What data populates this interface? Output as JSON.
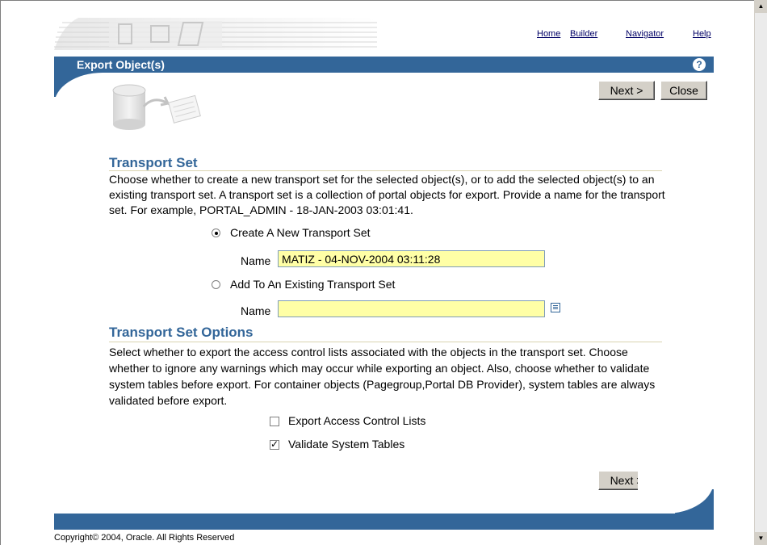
{
  "nav": {
    "home": "Home",
    "builder": "Builder",
    "navigator": "Navigator",
    "help": "Help"
  },
  "header": {
    "title": "Export Object(s)",
    "help_icon": "?"
  },
  "buttons": {
    "next": "Next >",
    "close": "Close"
  },
  "transport_set": {
    "title": "Transport Set",
    "description": "Choose whether to create a new transport set for the selected object(s), or to add the selected object(s) to an existing transport set. A transport set is a collection of portal objects for export. Provide a name for the transport set. For example, PORTAL_ADMIN - 18-JAN-2003 03:01:41.",
    "create_new_label": "Create A New Transport Set",
    "create_new_checked": true,
    "name_label": "Name",
    "new_name_value": "MATIZ - 04-NOV-2004 03:11:28",
    "add_existing_label": "Add To An Existing Transport Set",
    "add_existing_checked": false,
    "existing_name_value": ""
  },
  "options": {
    "title": "Transport Set Options",
    "description": "Select whether to export the access control lists associated with the objects in the transport set. Choose whether to ignore any warnings which may occur while exporting an object. Also, choose whether to validate system tables before export. For container objects (Pagegroup,Portal DB Provider), system tables are always validated before export.",
    "export_acl_label": "Export Access Control Lists",
    "export_acl_checked": false,
    "validate_label": "Validate System Tables",
    "validate_checked": true
  },
  "footer": {
    "copyright": "Copyright© 2004, Oracle. All Rights Reserved"
  },
  "colors": {
    "accent": "#336699",
    "field_bg": "#ffffa6"
  }
}
